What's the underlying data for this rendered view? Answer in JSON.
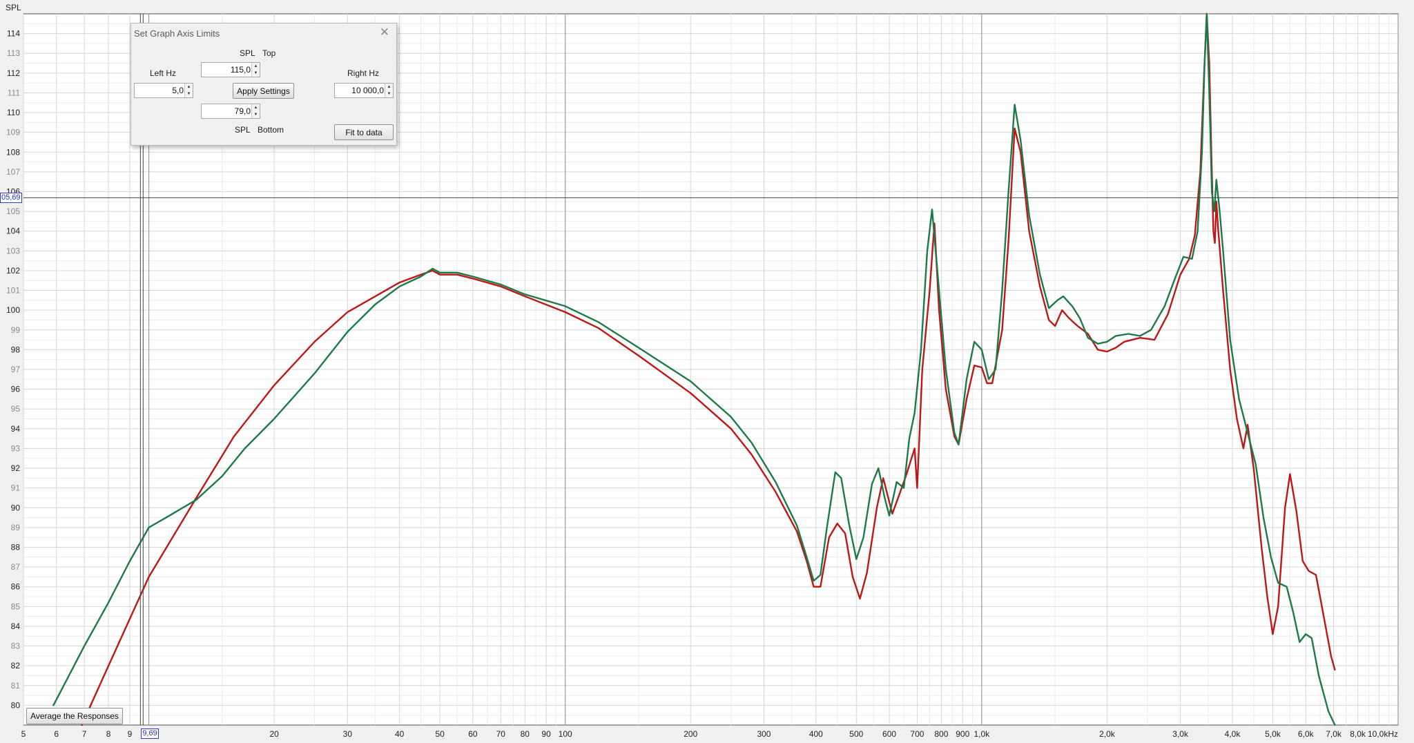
{
  "y_unit_label": "SPL",
  "cursor": {
    "spl_label": "05,69",
    "hz_label": "9,69"
  },
  "dialog": {
    "title": "Set Graph Axis Limits",
    "close_icon": "close-icon",
    "spl_top_caption": "SPL",
    "top_caption": "Top",
    "left_hz_caption": "Left Hz",
    "right_hz_caption": "Right Hz",
    "spl_bottom_caption": "SPL",
    "bottom_caption": "Bottom",
    "top_value": "115,0",
    "left_value": "5,0",
    "right_value": "10 000,0",
    "bottom_value": "79,0",
    "apply_label": "Apply Settings",
    "fit_label": "Fit to data"
  },
  "average_button": "Average the Responses",
  "chart_data": {
    "type": "line",
    "xscale": "log",
    "xlim": [
      5,
      10000
    ],
    "ylim": [
      79,
      115
    ],
    "grid": true,
    "ylabel": "SPL",
    "yticks": [
      80,
      81,
      82,
      83,
      84,
      85,
      86,
      87,
      88,
      89,
      90,
      91,
      92,
      93,
      94,
      95,
      96,
      97,
      98,
      99,
      100,
      101,
      102,
      103,
      104,
      105,
      106,
      107,
      108,
      109,
      110,
      111,
      112,
      113,
      114
    ],
    "xticks": [
      {
        "v": 5,
        "label": "5"
      },
      {
        "v": 6,
        "label": "6"
      },
      {
        "v": 7,
        "label": "7"
      },
      {
        "v": 8,
        "label": "8"
      },
      {
        "v": 9,
        "label": "9"
      },
      {
        "v": 20,
        "label": "20"
      },
      {
        "v": 30,
        "label": "30"
      },
      {
        "v": 40,
        "label": "40"
      },
      {
        "v": 50,
        "label": "50"
      },
      {
        "v": 60,
        "label": "60"
      },
      {
        "v": 70,
        "label": "70"
      },
      {
        "v": 80,
        "label": "80"
      },
      {
        "v": 90,
        "label": "90"
      },
      {
        "v": 100,
        "label": "100"
      },
      {
        "v": 200,
        "label": "200"
      },
      {
        "v": 300,
        "label": "300"
      },
      {
        "v": 400,
        "label": "400"
      },
      {
        "v": 500,
        "label": "500"
      },
      {
        "v": 600,
        "label": "600"
      },
      {
        "v": 700,
        "label": "700"
      },
      {
        "v": 800,
        "label": "800"
      },
      {
        "v": 900,
        "label": "900"
      },
      {
        "v": 1000,
        "label": "1,0k"
      },
      {
        "v": 2000,
        "label": "2,0k"
      },
      {
        "v": 3000,
        "label": "3,0k"
      },
      {
        "v": 4000,
        "label": "4,0k"
      },
      {
        "v": 5000,
        "label": "5,0k"
      },
      {
        "v": 6000,
        "label": "6,0k"
      },
      {
        "v": 7000,
        "label": "7,0k"
      },
      {
        "v": 8000,
        "label": "8,0k"
      },
      {
        "v": 10000,
        "label": "10,0kHz"
      }
    ],
    "cursor": {
      "x": 9.69,
      "y": 105.69
    },
    "series": [
      {
        "color": "#c01515",
        "points": [
          [
            6.9,
            79
          ],
          [
            8,
            82
          ],
          [
            10,
            86.5
          ],
          [
            13,
            90.5
          ],
          [
            16,
            93.6
          ],
          [
            20,
            96.2
          ],
          [
            25,
            98.4
          ],
          [
            30,
            99.9
          ],
          [
            35,
            100.7
          ],
          [
            40,
            101.4
          ],
          [
            45,
            101.8
          ],
          [
            48,
            102
          ],
          [
            50,
            101.8
          ],
          [
            55,
            101.8
          ],
          [
            60,
            101.6
          ],
          [
            70,
            101.2
          ],
          [
            80,
            100.7
          ],
          [
            100,
            99.9
          ],
          [
            120,
            99.1
          ],
          [
            150,
            97.7
          ],
          [
            200,
            95.8
          ],
          [
            250,
            94
          ],
          [
            280,
            92.7
          ],
          [
            320,
            90.8
          ],
          [
            360,
            88.8
          ],
          [
            380,
            87.3
          ],
          [
            395,
            86
          ],
          [
            410,
            86
          ],
          [
            430,
            88.5
          ],
          [
            450,
            89.2
          ],
          [
            470,
            88.7
          ],
          [
            490,
            86.5
          ],
          [
            510,
            85.4
          ],
          [
            530,
            86.7
          ],
          [
            560,
            90
          ],
          [
            580,
            91.5
          ],
          [
            610,
            89.7
          ],
          [
            635,
            90.7
          ],
          [
            660,
            91.7
          ],
          [
            690,
            93
          ],
          [
            700,
            91
          ],
          [
            720,
            97
          ],
          [
            750,
            101
          ],
          [
            770,
            104.4
          ],
          [
            790,
            100
          ],
          [
            820,
            96
          ],
          [
            860,
            93.6
          ],
          [
            880,
            93.2
          ],
          [
            920,
            95.5
          ],
          [
            960,
            97.2
          ],
          [
            1000,
            97.1
          ],
          [
            1030,
            96.3
          ],
          [
            1060,
            96.3
          ],
          [
            1120,
            99
          ],
          [
            1160,
            103.5
          ],
          [
            1200,
            109.2
          ],
          [
            1240,
            108
          ],
          [
            1300,
            104
          ],
          [
            1380,
            101.2
          ],
          [
            1450,
            99.5
          ],
          [
            1500,
            99.2
          ],
          [
            1560,
            100
          ],
          [
            1620,
            99.6
          ],
          [
            1700,
            99.2
          ],
          [
            1800,
            98.8
          ],
          [
            1900,
            98
          ],
          [
            2000,
            97.9
          ],
          [
            2100,
            98.1
          ],
          [
            2200,
            98.4
          ],
          [
            2400,
            98.6
          ],
          [
            2600,
            98.5
          ],
          [
            2800,
            99.8
          ],
          [
            3000,
            101.8
          ],
          [
            3150,
            102.6
          ],
          [
            3250,
            103.8
          ],
          [
            3350,
            107
          ],
          [
            3420,
            112
          ],
          [
            3470,
            115
          ],
          [
            3520,
            112.5
          ],
          [
            3560,
            108
          ],
          [
            3600,
            104
          ],
          [
            3630,
            103.4
          ],
          [
            3660,
            105.5
          ],
          [
            3700,
            104
          ],
          [
            3800,
            101
          ],
          [
            3950,
            97
          ],
          [
            4100,
            94.5
          ],
          [
            4250,
            93
          ],
          [
            4350,
            94.2
          ],
          [
            4500,
            92
          ],
          [
            4700,
            88
          ],
          [
            4850,
            85.5
          ],
          [
            5000,
            83.6
          ],
          [
            5150,
            85
          ],
          [
            5350,
            90
          ],
          [
            5500,
            91.7
          ],
          [
            5700,
            89.8
          ],
          [
            5900,
            87.3
          ],
          [
            6100,
            86.8
          ],
          [
            6350,
            86.6
          ],
          [
            6600,
            84.7
          ],
          [
            6900,
            82.5
          ],
          [
            7050,
            81.8
          ]
        ]
      },
      {
        "color": "#1a7a48",
        "points": [
          [
            5.9,
            80
          ],
          [
            7,
            83
          ],
          [
            8,
            85.2
          ],
          [
            9,
            87.3
          ],
          [
            10,
            89
          ],
          [
            11,
            89.5
          ],
          [
            13,
            90.4
          ],
          [
            15,
            91.6
          ],
          [
            17,
            93
          ],
          [
            20,
            94.5
          ],
          [
            25,
            96.8
          ],
          [
            30,
            98.9
          ],
          [
            35,
            100.3
          ],
          [
            40,
            101.2
          ],
          [
            45,
            101.7
          ],
          [
            48,
            102.1
          ],
          [
            50,
            101.9
          ],
          [
            55,
            101.9
          ],
          [
            60,
            101.7
          ],
          [
            70,
            101.3
          ],
          [
            80,
            100.8
          ],
          [
            100,
            100.2
          ],
          [
            120,
            99.4
          ],
          [
            150,
            98.1
          ],
          [
            200,
            96.4
          ],
          [
            250,
            94.6
          ],
          [
            280,
            93.3
          ],
          [
            320,
            91.3
          ],
          [
            360,
            89.1
          ],
          [
            380,
            87.5
          ],
          [
            395,
            86.3
          ],
          [
            410,
            86.6
          ],
          [
            425,
            89
          ],
          [
            445,
            91.8
          ],
          [
            460,
            91.5
          ],
          [
            480,
            89.2
          ],
          [
            500,
            87.4
          ],
          [
            520,
            88.5
          ],
          [
            545,
            91.2
          ],
          [
            565,
            92
          ],
          [
            585,
            90.5
          ],
          [
            600,
            89.6
          ],
          [
            625,
            91.3
          ],
          [
            650,
            91
          ],
          [
            670,
            93.5
          ],
          [
            690,
            94.8
          ],
          [
            715,
            98
          ],
          [
            740,
            103
          ],
          [
            760,
            105.1
          ],
          [
            790,
            101
          ],
          [
            820,
            97
          ],
          [
            860,
            93.8
          ],
          [
            880,
            93.2
          ],
          [
            920,
            96.5
          ],
          [
            960,
            98.4
          ],
          [
            1000,
            98
          ],
          [
            1040,
            96.5
          ],
          [
            1080,
            97
          ],
          [
            1120,
            101
          ],
          [
            1160,
            106
          ],
          [
            1200,
            110.4
          ],
          [
            1240,
            108.6
          ],
          [
            1300,
            104.8
          ],
          [
            1380,
            101.8
          ],
          [
            1450,
            100.1
          ],
          [
            1520,
            100.5
          ],
          [
            1570,
            100.7
          ],
          [
            1650,
            100.2
          ],
          [
            1720,
            99.6
          ],
          [
            1800,
            98.6
          ],
          [
            1900,
            98.3
          ],
          [
            2000,
            98.4
          ],
          [
            2100,
            98.7
          ],
          [
            2250,
            98.8
          ],
          [
            2400,
            98.7
          ],
          [
            2550,
            99
          ],
          [
            2750,
            100.2
          ],
          [
            2900,
            101.5
          ],
          [
            3050,
            102.7
          ],
          [
            3200,
            102.6
          ],
          [
            3300,
            104
          ],
          [
            3380,
            108
          ],
          [
            3430,
            112.5
          ],
          [
            3470,
            115
          ],
          [
            3520,
            111
          ],
          [
            3570,
            106
          ],
          [
            3620,
            105
          ],
          [
            3660,
            106.6
          ],
          [
            3720,
            105.2
          ],
          [
            3800,
            103
          ],
          [
            3950,
            98.5
          ],
          [
            4150,
            95.5
          ],
          [
            4350,
            93.8
          ],
          [
            4550,
            92.2
          ],
          [
            4750,
            89.5
          ],
          [
            4950,
            87.5
          ],
          [
            5150,
            86.2
          ],
          [
            5400,
            86
          ],
          [
            5600,
            84.7
          ],
          [
            5800,
            83.2
          ],
          [
            6000,
            83.6
          ],
          [
            6200,
            83.4
          ],
          [
            6450,
            81.5
          ],
          [
            6800,
            79.7
          ],
          [
            7050,
            79
          ]
        ]
      }
    ]
  }
}
